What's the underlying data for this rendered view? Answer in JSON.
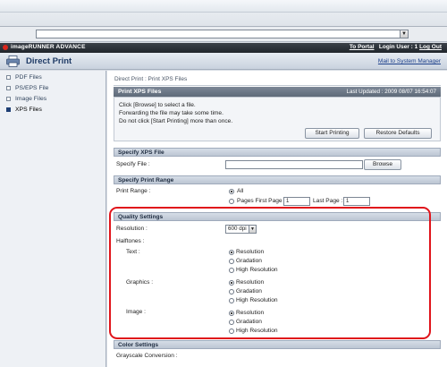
{
  "browser": {
    "url_value": "",
    "dropdown_arrow": "▼"
  },
  "brand": {
    "name": "imageRUNNER ADVANCE",
    "to_portal": "To Portal",
    "login_user": "Login User : 1",
    "logout": "Log Out"
  },
  "app": {
    "title": "Direct Print",
    "mail_link": "Mail to System Manager"
  },
  "sidebar": {
    "items": [
      {
        "label": "PDF Files"
      },
      {
        "label": "PS/EPS File"
      },
      {
        "label": "Image Files"
      },
      {
        "label": "XPS Files"
      }
    ]
  },
  "main": {
    "breadcrumb": "Direct Print : Print XPS Files",
    "panel_title": "Print XPS Files",
    "last_updated": "Last Updated : 2009 08/07 16:54:07",
    "instructions": [
      "Click [Browse] to select a file.",
      "Forwarding the file may take some time.",
      "Do not click [Start Printing] more than once."
    ],
    "start_btn": "Start Printing",
    "restore_btn": "Restore Defaults"
  },
  "specify_file": {
    "header": "Specify XPS File",
    "label": "Specify File :",
    "value": "",
    "browse": "Browse"
  },
  "print_range": {
    "header": "Specify Print Range",
    "label": "Print Range :",
    "all": "All",
    "pages": "Pages First Page :",
    "first_value": "1",
    "last_label": "Last Page :",
    "last_value": "1"
  },
  "quality": {
    "header": "Quality Settings",
    "resolution_label": "Resolution :",
    "resolution_value": "600 dpi",
    "halftones_label": "Halftones :",
    "text_label": "Text :",
    "graphics_label": "Graphics :",
    "image_label": "Image :",
    "opt_resolution": "Resolution",
    "opt_gradation": "Gradation",
    "opt_high": "High Resolution"
  },
  "color": {
    "header": "Color Settings",
    "grayscale_label": "Grayscale Conversion :"
  },
  "colors": {
    "highlight": "#e0141b",
    "brand_red": "#d9261c"
  }
}
